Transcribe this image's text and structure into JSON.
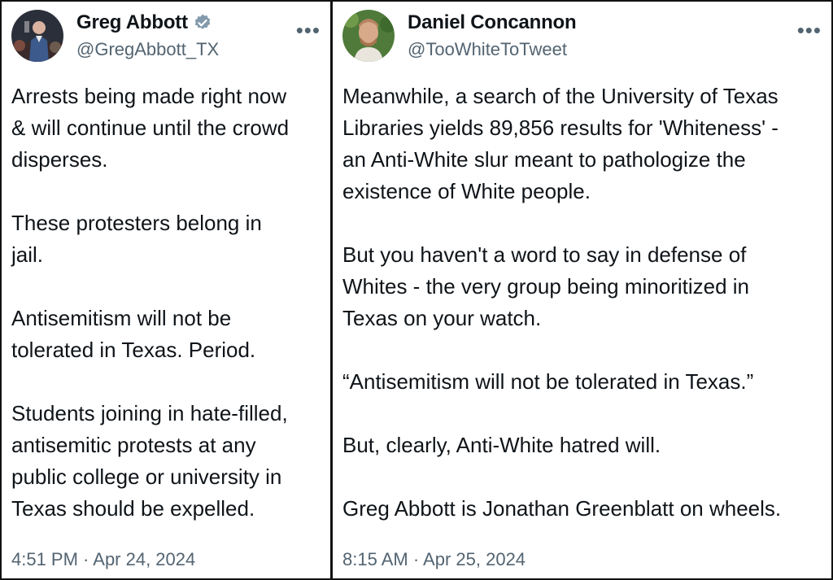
{
  "tweets": [
    {
      "author_name": "Greg Abbott",
      "handle": "@GregAbbott_TX",
      "verified": true,
      "verified_color": "#829aab",
      "more_icon": "more-horizontal-icon",
      "paragraphs": [
        [
          "Arrests being made right now",
          "& will continue until the crowd",
          "disperses."
        ],
        [
          "These protesters belong in",
          "jail."
        ],
        [
          "Antisemitism will not be",
          "tolerated in Texas. Period."
        ],
        [
          "Students joining in hate-filled,",
          "antisemitic protests at any",
          "public college or university in",
          "Texas should be expelled."
        ]
      ],
      "timestamp": "4:51 PM · Apr 24, 2024"
    },
    {
      "author_name": "Daniel Concannon",
      "handle": "@TooWhiteToTweet",
      "verified": false,
      "more_icon": "more-horizontal-icon",
      "paragraphs": [
        [
          "Meanwhile, a search of the University of Texas",
          "Libraries yields 89,856 results for 'Whiteness' -",
          "an Anti-White slur meant to pathologize the",
          "existence of White people."
        ],
        [
          "But you haven't a word to say in defense of",
          "Whites - the very group being minoritized in",
          "Texas on your watch."
        ],
        [
          "“Antisemitism will not be tolerated in Texas.”"
        ],
        [
          "But, clearly, Anti-White hatred will."
        ],
        [
          "Greg Abbott is Jonathan Greenblatt on wheels."
        ]
      ],
      "timestamp": "8:15 AM · Apr 25, 2024"
    }
  ],
  "colors": {
    "text": "#0f1419",
    "secondary": "#536471",
    "divider": "#111111"
  }
}
